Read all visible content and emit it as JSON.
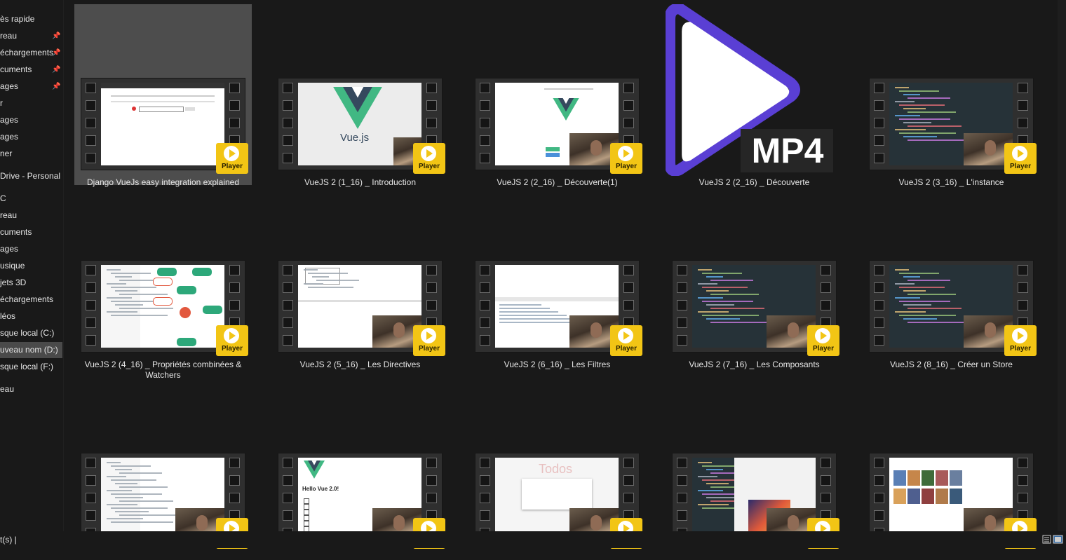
{
  "sidebar": {
    "items": [
      {
        "label": "ès rapide",
        "pinned": false
      },
      {
        "label": "reau",
        "pinned": true
      },
      {
        "label": "échargements",
        "pinned": true
      },
      {
        "label": "cuments",
        "pinned": true
      },
      {
        "label": "ages",
        "pinned": true
      },
      {
        "label": "r",
        "pinned": false
      },
      {
        "label": "ages",
        "pinned": false
      },
      {
        "label": "ages",
        "pinned": false
      },
      {
        "label": "ner",
        "pinned": false
      },
      {
        "label": "Drive - Personal",
        "pinned": false
      },
      {
        "label": "C",
        "pinned": false
      },
      {
        "label": "reau",
        "pinned": false
      },
      {
        "label": "cuments",
        "pinned": false
      },
      {
        "label": "ages",
        "pinned": false
      },
      {
        "label": "usique",
        "pinned": false
      },
      {
        "label": "jets 3D",
        "pinned": false
      },
      {
        "label": "échargements",
        "pinned": false
      },
      {
        "label": "léos",
        "pinned": false
      },
      {
        "label": "sque local (C:)",
        "pinned": false
      },
      {
        "label": "uveau nom (D:)",
        "pinned": false,
        "selected": true
      },
      {
        "label": "sque local (F:)",
        "pinned": false
      },
      {
        "label": "eau",
        "pinned": false
      }
    ],
    "pin_glyph": "📌"
  },
  "files": [
    {
      "name": "Django VueJs easy integration explained",
      "thumb": "todo-app",
      "selected": true
    },
    {
      "name": "VueJS 2 (1_16) _ Introduction",
      "thumb": "vue-logo"
    },
    {
      "name": "VueJS 2 (2_16) _ Découverte(1)",
      "thumb": "vue-site"
    },
    {
      "name": "VueJS 2 (2_16) _ Découverte",
      "thumb": "mp4-icon",
      "icon_text": "MP4"
    },
    {
      "name": "VueJS 2 (3_16) _ L'instance",
      "thumb": "code-dark"
    },
    {
      "name": "VueJS 2 (4_16) _ Propriétés combinées & Watchers",
      "thumb": "flowchart"
    },
    {
      "name": "VueJS 2 (5_16) _ Les Directives",
      "thumb": "browser-console"
    },
    {
      "name": "VueJS 2 (6_16) _ Les Filtres",
      "thumb": "devtools"
    },
    {
      "name": "VueJS 2 (7_16) _ Les Composants",
      "thumb": "code-dark"
    },
    {
      "name": "VueJS 2 (8_16) _ Créer un Store",
      "thumb": "code-dark"
    },
    {
      "name": "",
      "thumb": "docs"
    },
    {
      "name": "",
      "thumb": "hello-vue",
      "thumb_text": "Hello Vue 2.0!"
    },
    {
      "name": "",
      "thumb": "todos",
      "thumb_text": "Todos"
    },
    {
      "name": "",
      "thumb": "code-browser"
    },
    {
      "name": "",
      "thumb": "gallery"
    }
  ],
  "player_label": "Player",
  "vue_wordmark": "Vue.js",
  "statusbar": {
    "text": "t(s)  |"
  },
  "colors": {
    "accent_purple": "#5a3fd4",
    "player_yellow": "#f2c515",
    "vue_green": "#41b883",
    "vue_navy": "#35495e"
  }
}
